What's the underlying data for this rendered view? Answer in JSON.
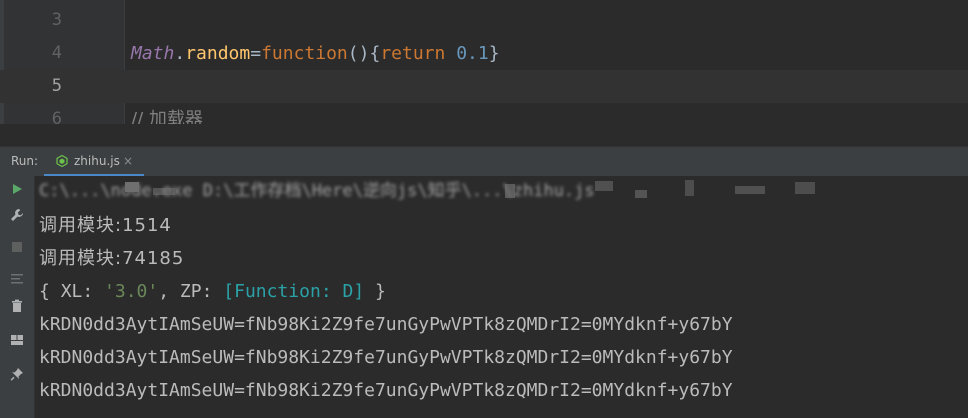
{
  "editor": {
    "lines": [
      {
        "number": "3",
        "content": ""
      },
      {
        "number": "4",
        "tokens": {
          "object": "Math",
          "dot": ".",
          "property": "random",
          "eq": "=",
          "keyword": "function",
          "parens": "()",
          "open": "{",
          "ret": "return",
          "value": "0.1",
          "close": "}"
        }
      },
      {
        "number": "5",
        "content": ""
      },
      {
        "number": "6",
        "comment_prefix": "//",
        "comment_text": "加载器"
      }
    ]
  },
  "run_panel": {
    "label": "Run:",
    "tab": {
      "label": "zhihu.js",
      "close": "×"
    }
  },
  "toolbar": {
    "icons": [
      "run-icon",
      "wrench-icon",
      "stop-icon",
      "sort-icon",
      "trash-icon",
      "layout-icon",
      "pin-icon"
    ]
  },
  "console": {
    "command_line": "C:\\...\\node.exe D:\\工作存档\\Here\\逆向js\\知乎\\...\\zhihu.js",
    "lines": [
      "调用模块:1514",
      "调用模块:74185"
    ],
    "object_line": {
      "open": "{ ",
      "key1": "XL: ",
      "value1": "'3.0'",
      "sep": ", ",
      "key2": "ZP: ",
      "value2": "[Function: D]",
      "close": " }"
    },
    "tokens": [
      "kRDN0dd3AytIAmSeUW=fNb98Ki2Z9fe7unGyPwVPTk8zQMDrI2=0MYdknf+y67bY",
      "kRDN0dd3AytIAmSeUW=fNb98Ki2Z9fe7unGyPwVPTk8zQMDrI2=0MYdknf+y67bY",
      "kRDN0dd3AytIAmSeUW=fNb98Ki2Z9fe7unGyPwVPTk8zQMDrI2=0MYdknf+y67bY"
    ]
  },
  "colors": {
    "editor_bg": "#2b2b2b",
    "string": "#6a8759",
    "function_ref": "#2aa1a6",
    "keyword": "#cc7832",
    "accent": "#4a88c7"
  }
}
